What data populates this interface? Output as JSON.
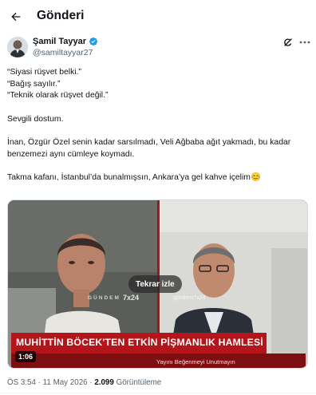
{
  "header": {
    "title": "Gönderi",
    "back_icon": "arrow-left-icon"
  },
  "author": {
    "name": "Şamil Tayyar",
    "handle": "@samiltayyar27",
    "verified_color": "#1d9bf0"
  },
  "actions": {
    "grok_icon": "grok-icon",
    "more_icon": "more-horizontal-icon"
  },
  "tweet": {
    "lines": [
      "“Siyasi rüşvet belki.”",
      "“Bağış sayılır.”",
      "“Teknik olarak rüşvet değil.”"
    ],
    "p2": "Sevgili dostum.",
    "p3": "İnan, Özgür Özel senin kadar sarsılmadı, Veli Ağbaba ağıt yakmadı, bu kadar benzemezi aynı cümleye koymadı.",
    "p4": "Takma kafanı, İstanbul’da bunalmışsın, Ankara’ya gel kahve içelim😊"
  },
  "media": {
    "replay_label": "Tekrar izle",
    "duration": "1:06",
    "watermark_left": "GÜNDEM",
    "watermark_mid": "7x24",
    "watermark_handle": "gündem7x24",
    "headline": "MUHİTTİN BÖCEK'TEN ETKİN PİŞMANLIK HAMLESİ",
    "ticker": "Yayını Beğenmeyi Unutmayın"
  },
  "meta": {
    "time": "ÖS 3:54",
    "sep": " · ",
    "date": "11 May 2026",
    "views_count": "2.099",
    "views_label": "Görüntüleme"
  }
}
